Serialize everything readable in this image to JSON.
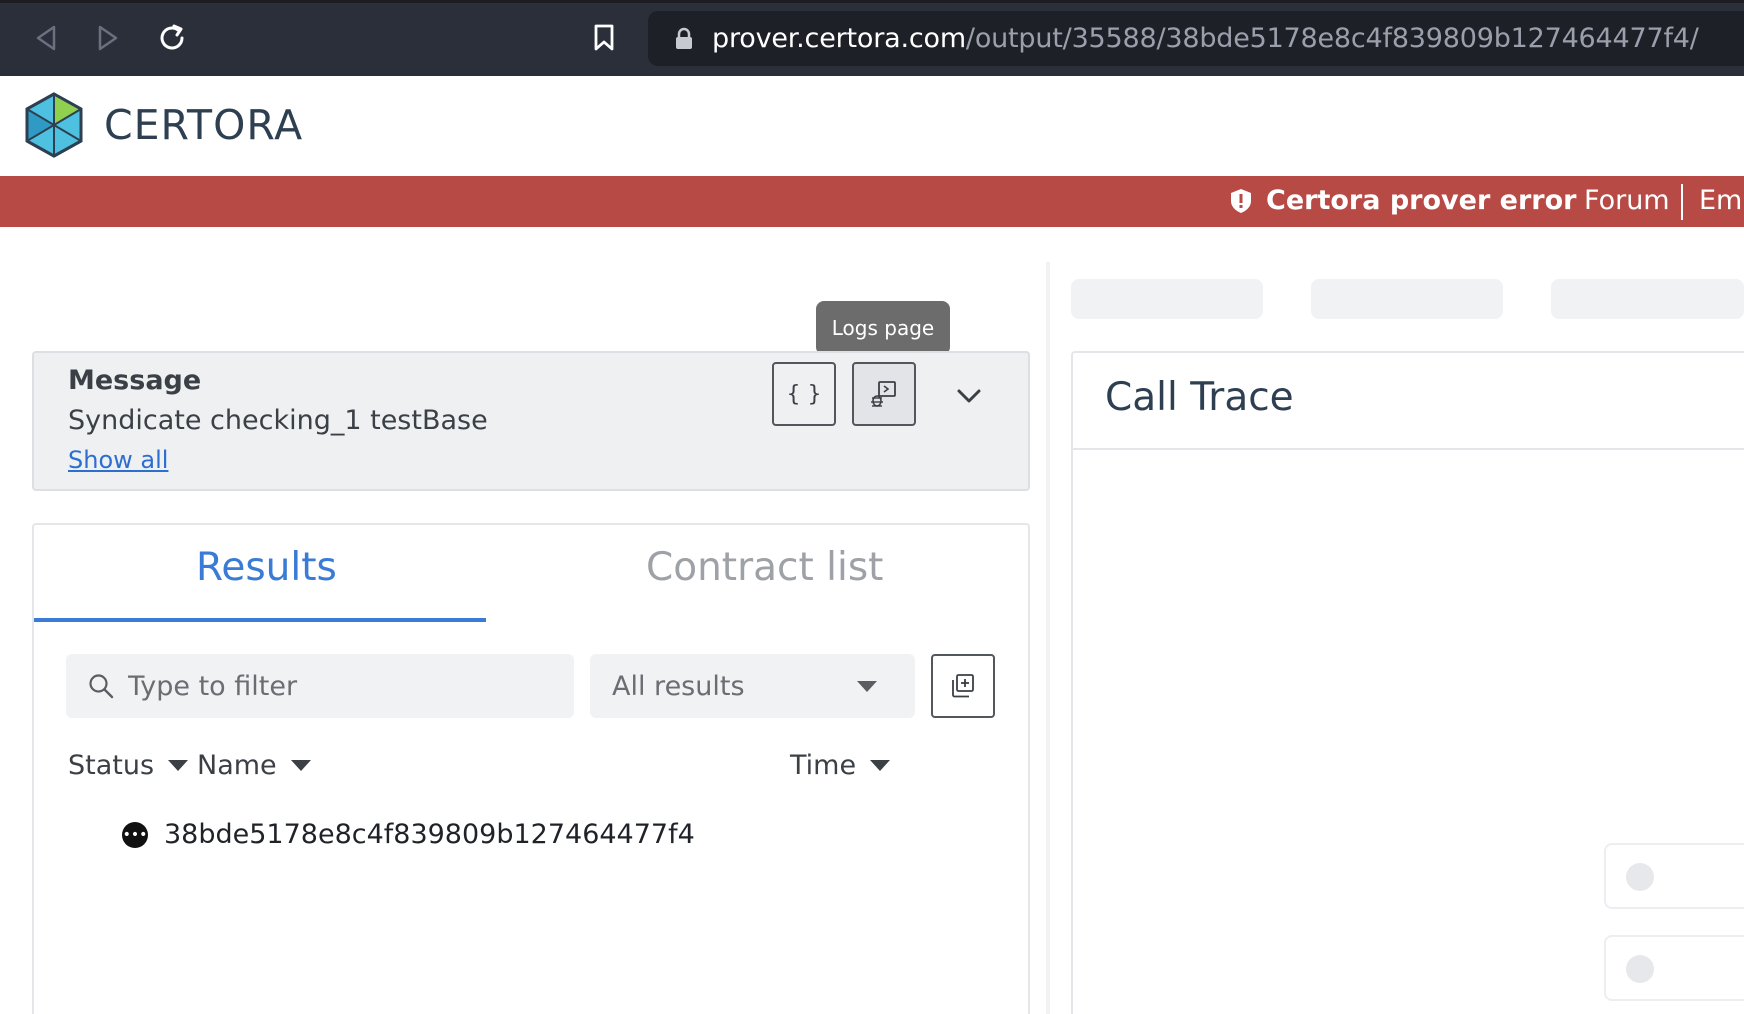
{
  "browser": {
    "url_host": "prover.certora.com",
    "url_path": "/output/35588/38bde5178e8c4f839809b127464477f4/"
  },
  "header": {
    "brand": "CERTORA"
  },
  "error_bar": {
    "message": "Certora prover error",
    "forum_link": "Forum",
    "email_link": "Ema"
  },
  "tooltip": {
    "text": "Logs page"
  },
  "message_card": {
    "title": "Message",
    "body": "Syndicate checking_1 testBase",
    "show_all": "Show all",
    "json_button_glyph": "{ }"
  },
  "tabs": {
    "results": "Results",
    "contract_list": "Contract list"
  },
  "filter": {
    "placeholder": "Type to filter",
    "select_value": "All results"
  },
  "columns": {
    "status": "Status",
    "name": "Name",
    "time": "Time"
  },
  "rows": [
    {
      "status_icon": "ellipsis-circle-icon",
      "status_glyph": "•••",
      "name": "38bde5178e8c4f839809b127464477f4"
    }
  ],
  "call_trace": {
    "title": "Call Trace"
  },
  "colors": {
    "error_bar": "#b74a45",
    "accent_blue": "#3a7bd5",
    "brand_text": "#2e3f51"
  }
}
